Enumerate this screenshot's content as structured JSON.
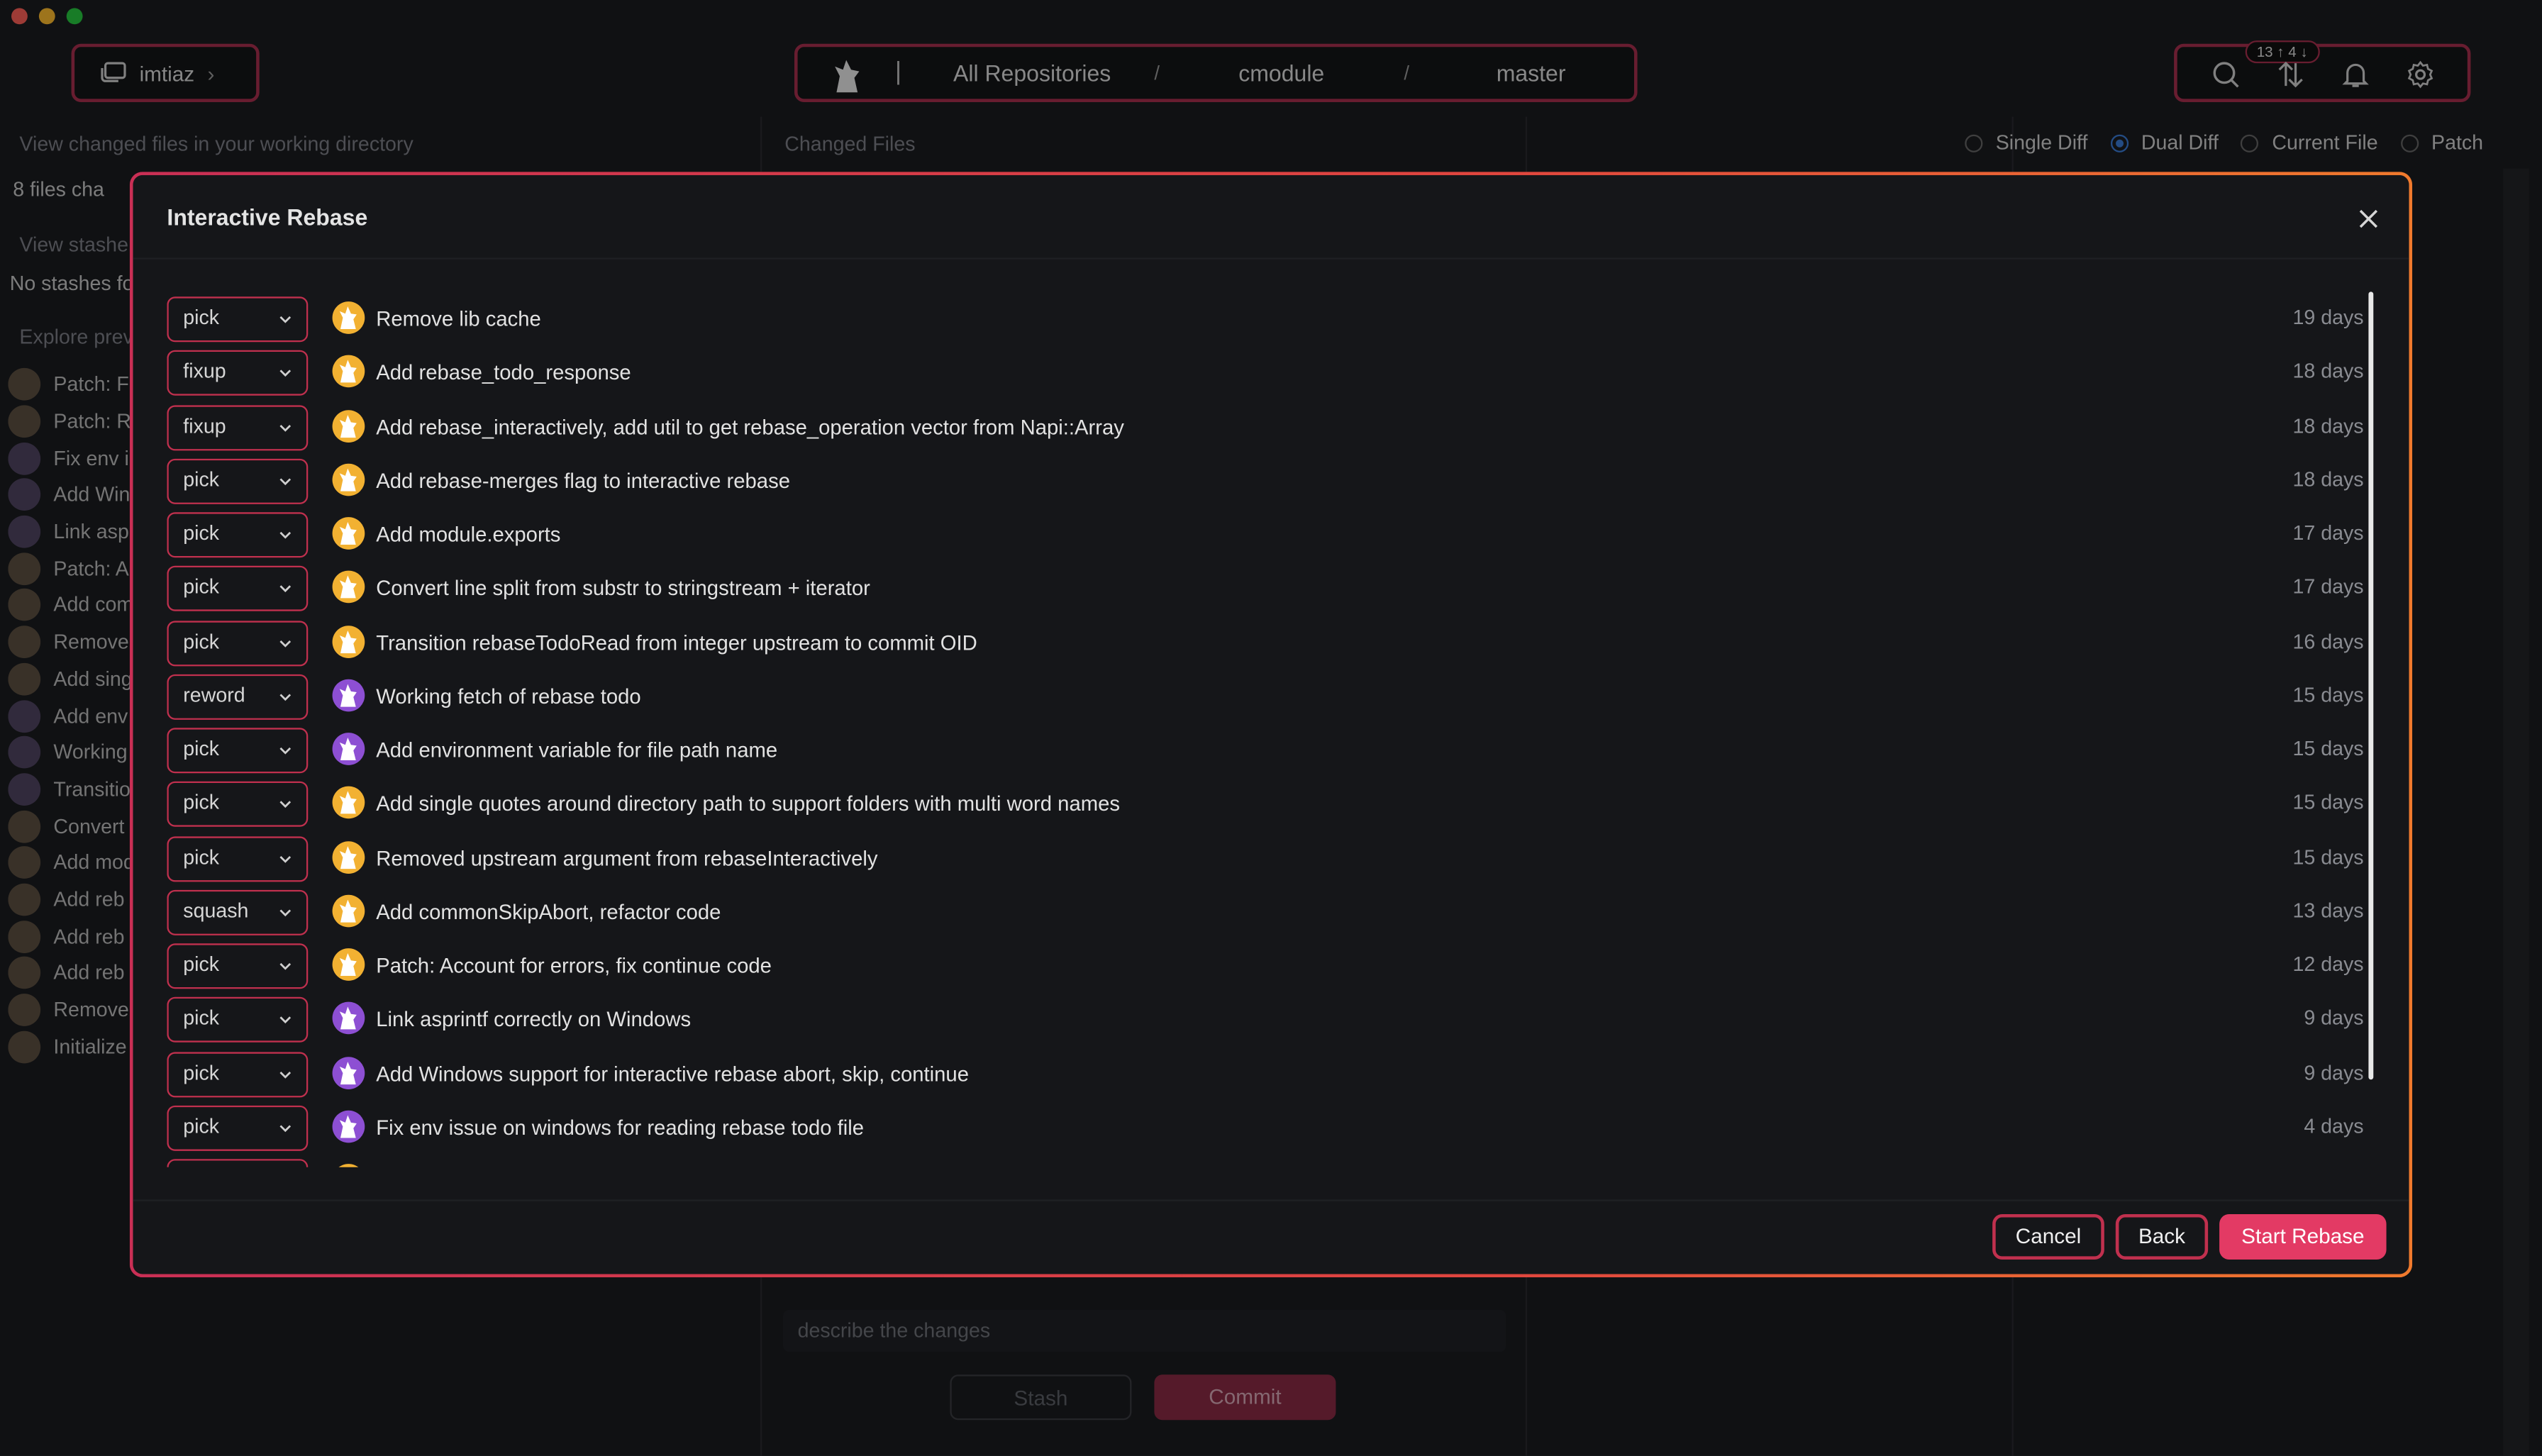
{
  "header": {
    "user": "imtiaz",
    "breadcrumb": [
      "All Repositories",
      "cmodule",
      "master"
    ],
    "sync_badge": "13 ↑ 4 ↓",
    "icons": [
      "search-icon",
      "sync-icon",
      "bell-icon",
      "gear-icon"
    ]
  },
  "background": {
    "left_hint": "View changed files in your working directory",
    "files_changed": "8 files cha",
    "stash_hint": "View stashe",
    "no_stashes": "No stashes fo",
    "explore": "Explore prev",
    "changed_files_title": "Changed Files",
    "diff_modes": [
      "Single Diff",
      "Dual Diff",
      "Current File",
      "Patch"
    ],
    "selected_diff_mode": "Dual Diff",
    "history": [
      "Patch: F",
      "Patch: R",
      "Fix env i",
      "Add Win",
      "Link asp",
      "Patch: A",
      "Add com",
      "Remove",
      "Add sing",
      "Add env",
      "Working",
      "Transitio",
      "Convert",
      "Add mod",
      "Add reb",
      "Add reb",
      "Add reb",
      "Remove",
      "Initialize"
    ],
    "commit_placeholder": "describe the changes",
    "stash_label": "Stash",
    "commit_label": "Commit"
  },
  "modal": {
    "title": "Interactive Rebase",
    "commits": [
      {
        "action": "pick",
        "message": "Remove lib cache",
        "age": "19 days",
        "avatar": "gold"
      },
      {
        "action": "fixup",
        "message": "Add rebase_todo_response",
        "age": "18 days",
        "avatar": "gold"
      },
      {
        "action": "fixup",
        "message": "Add rebase_interactively, add util to get rebase_operation vector from Napi::Array",
        "age": "18 days",
        "avatar": "gold"
      },
      {
        "action": "pick",
        "message": "Add rebase-merges flag to interactive rebase",
        "age": "18 days",
        "avatar": "gold"
      },
      {
        "action": "pick",
        "message": "Add module.exports",
        "age": "17 days",
        "avatar": "gold"
      },
      {
        "action": "pick",
        "message": "Convert line split from substr to stringstream + iterator",
        "age": "17 days",
        "avatar": "gold"
      },
      {
        "action": "pick",
        "message": "Transition rebaseTodoRead from integer upstream to commit OID",
        "age": "16 days",
        "avatar": "gold"
      },
      {
        "action": "reword",
        "message": "Working fetch of rebase todo",
        "age": "15 days",
        "avatar": "purple"
      },
      {
        "action": "pick",
        "message": "Add environment variable for file path name",
        "age": "15 days",
        "avatar": "purple"
      },
      {
        "action": "pick",
        "message": "Add single quotes around directory path to support folders with multi word names",
        "age": "15 days",
        "avatar": "gold"
      },
      {
        "action": "pick",
        "message": "Removed upstream argument from rebaseInteractively",
        "age": "15 days",
        "avatar": "gold"
      },
      {
        "action": "squash",
        "message": "Add commonSkipAbort, refactor code",
        "age": "13 days",
        "avatar": "gold"
      },
      {
        "action": "pick",
        "message": "Patch: Account for errors, fix continue code",
        "age": "12 days",
        "avatar": "gold"
      },
      {
        "action": "pick",
        "message": "Link asprintf correctly on Windows",
        "age": "9 days",
        "avatar": "purple"
      },
      {
        "action": "pick",
        "message": "Add Windows support for interactive rebase abort, skip, continue",
        "age": "9 days",
        "avatar": "purple"
      },
      {
        "action": "pick",
        "message": "Fix env issue on windows for reading rebase todo file",
        "age": "4 days",
        "avatar": "purple"
      }
    ],
    "cancel_label": "Cancel",
    "back_label": "Back",
    "start_label": "Start Rebase"
  },
  "colors": {
    "accent": "#e33a64",
    "border_accent": "#c0304e",
    "avatar_gold": "#f2b132",
    "avatar_purple": "#8d4fd3"
  }
}
